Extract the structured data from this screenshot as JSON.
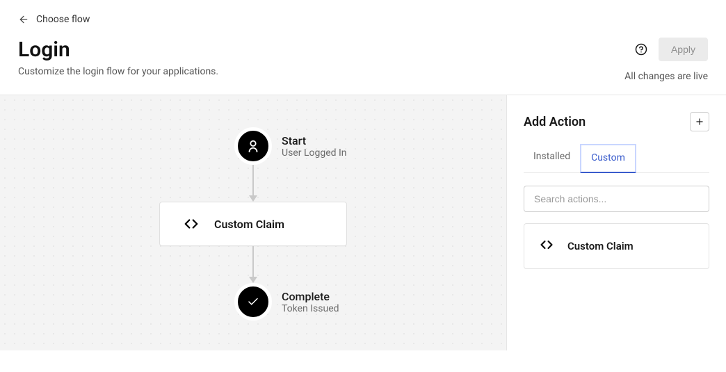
{
  "back": {
    "label": "Choose flow"
  },
  "page": {
    "title": "Login",
    "subtitle": "Customize the login flow for your applications."
  },
  "controls": {
    "apply_label": "Apply",
    "status": "All changes are live"
  },
  "flow": {
    "start": {
      "title": "Start",
      "sub": "User Logged In"
    },
    "action_card": {
      "title": "Custom Claim"
    },
    "complete": {
      "title": "Complete",
      "sub": "Token Issued"
    }
  },
  "sidebar": {
    "heading": "Add Action",
    "tabs": {
      "installed": "Installed",
      "custom": "Custom"
    },
    "search_placeholder": "Search actions...",
    "actions": [
      {
        "title": "Custom Claim"
      }
    ]
  }
}
